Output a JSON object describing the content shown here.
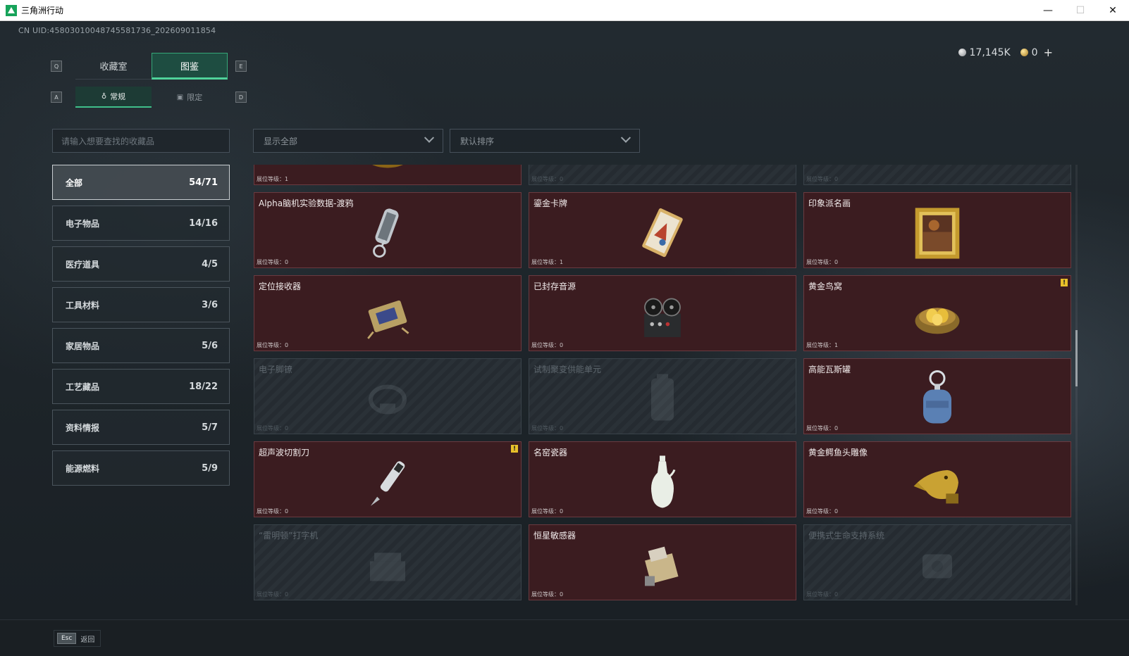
{
  "window": {
    "title": "三角洲行动",
    "minimize": "—",
    "maximize": "☐",
    "close": "✕"
  },
  "uid": "CN UID:4580301004874558173​6_202609011854",
  "currency": {
    "silver": "17,145K",
    "gold": "0",
    "add": "+"
  },
  "keys": {
    "prev_tab": "Q",
    "next_tab": "E",
    "prev_sub": "A",
    "next_sub": "D"
  },
  "main_tabs": [
    {
      "label": "收藏室",
      "active": false
    },
    {
      "label": "图鉴",
      "active": true
    }
  ],
  "sub_tabs": [
    {
      "label": "常规",
      "icon": "bottle-icon",
      "glyph": "♁",
      "active": true
    },
    {
      "label": "限定",
      "icon": "picture-icon",
      "glyph": "▣",
      "active": false
    }
  ],
  "search": {
    "placeholder": "请输入想要查找的收藏品"
  },
  "filter": {
    "value": "显示全部"
  },
  "sort": {
    "value": "默认排序"
  },
  "categories": [
    {
      "label": "全部",
      "count": "54/71",
      "active": true
    },
    {
      "label": "电子物品",
      "count": "14/16"
    },
    {
      "label": "医疗道具",
      "count": "4/5"
    },
    {
      "label": "工具材料",
      "count": "3/6"
    },
    {
      "label": "家居物品",
      "count": "5/6"
    },
    {
      "label": "工艺藏品",
      "count": "18/22"
    },
    {
      "label": "资料情报",
      "count": "5/7"
    },
    {
      "label": "能源燃料",
      "count": "5/9"
    }
  ],
  "level_prefix": "展位等级：",
  "items": [
    {
      "name": "",
      "level": "1",
      "locked": false,
      "icon": "caviar-tin-icon",
      "alert": false
    },
    {
      "name": "",
      "level": "0",
      "locked": true,
      "icon": "unknown-item-icon",
      "alert": false
    },
    {
      "name": "",
      "level": "0",
      "locked": true,
      "icon": "unknown-item-icon",
      "alert": false
    },
    {
      "name": "Alpha脑机实验数据-渡鸦",
      "level": "0",
      "locked": false,
      "icon": "data-drive-icon",
      "alert": false
    },
    {
      "name": "鎏金卡牌",
      "level": "1",
      "locked": false,
      "icon": "gilded-card-icon",
      "alert": false
    },
    {
      "name": "印象派名画",
      "level": "0",
      "locked": false,
      "icon": "framed-painting-icon",
      "alert": false
    },
    {
      "name": "定位接收器",
      "level": "0",
      "locked": false,
      "icon": "receiver-icon",
      "alert": false
    },
    {
      "name": "已封存音源",
      "level": "0",
      "locked": false,
      "icon": "tape-recorder-icon",
      "alert": false
    },
    {
      "name": "黄金鸟窝",
      "level": "1",
      "locked": false,
      "icon": "golden-nest-icon",
      "alert": true
    },
    {
      "name": "电子脚镣",
      "level": "0",
      "locked": true,
      "icon": "ankle-monitor-icon",
      "alert": false
    },
    {
      "name": "试制聚变供能单元",
      "level": "0",
      "locked": true,
      "icon": "fusion-cell-icon",
      "alert": false
    },
    {
      "name": "高能瓦斯罐",
      "level": "0",
      "locked": false,
      "icon": "gas-tank-icon",
      "alert": false
    },
    {
      "name": "超声波切割刀",
      "level": "0",
      "locked": false,
      "icon": "ultrasonic-knife-icon",
      "alert": true
    },
    {
      "name": "名窑瓷器",
      "level": "0",
      "locked": false,
      "icon": "porcelain-vase-icon",
      "alert": false
    },
    {
      "name": "黄金鳄鱼头雕像",
      "level": "0",
      "locked": false,
      "icon": "gold-crocodile-icon",
      "alert": false
    },
    {
      "name": "“雷明顿”打字机",
      "level": "0",
      "locked": true,
      "icon": "typewriter-icon",
      "alert": false
    },
    {
      "name": "恒星敏感器",
      "level": "0",
      "locked": false,
      "icon": "star-sensor-icon",
      "alert": false
    },
    {
      "name": "便携式生命支持系统",
      "level": "0",
      "locked": true,
      "icon": "life-support-icon",
      "alert": false
    }
  ],
  "back": {
    "key": "Esc",
    "label": "返回"
  }
}
